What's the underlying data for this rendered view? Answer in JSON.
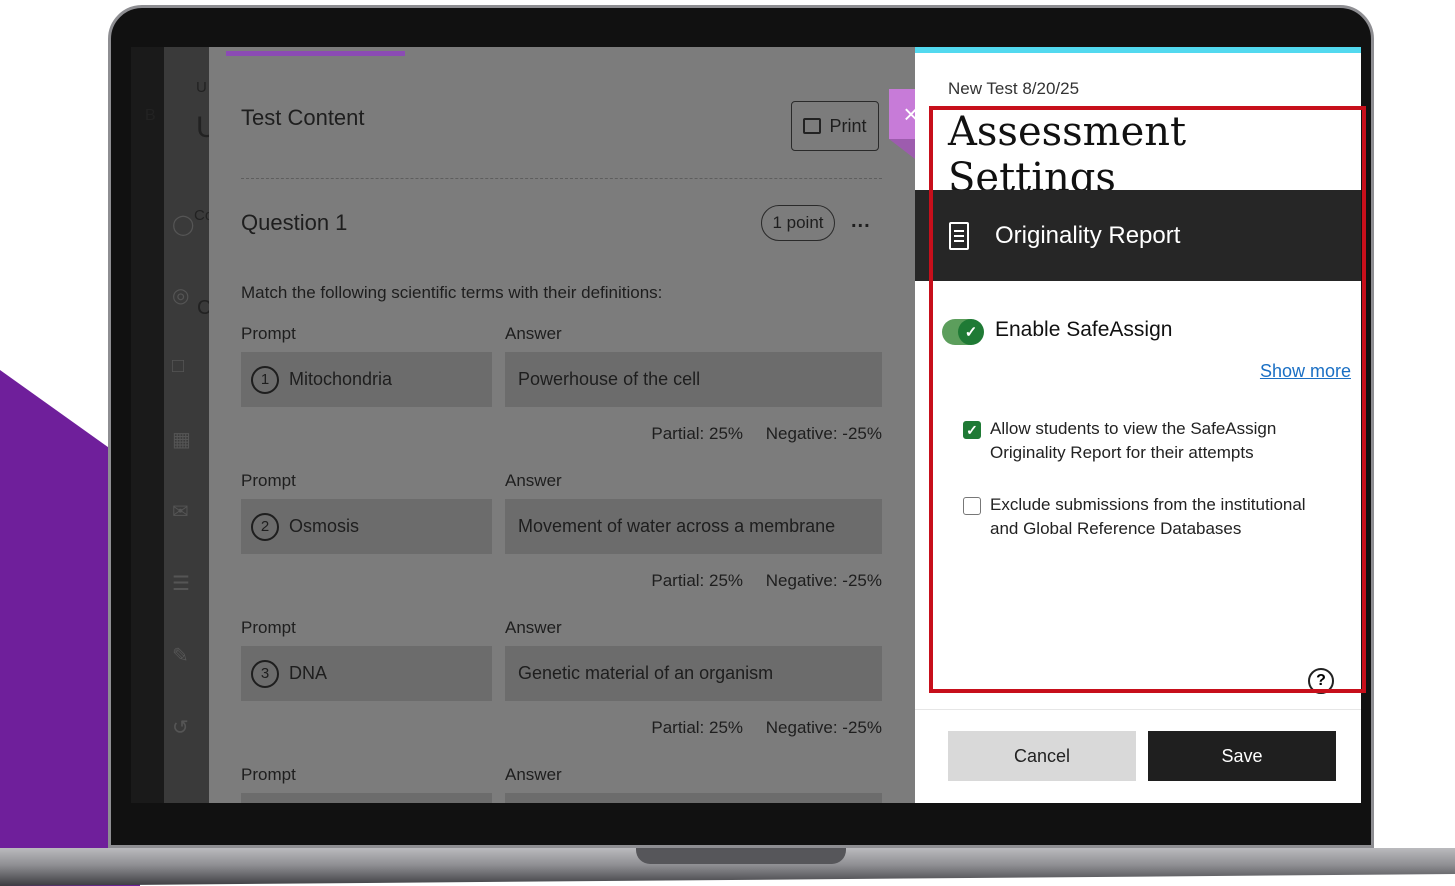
{
  "colors": {
    "accent_purple": "#6f1f9b",
    "toggle_green": "#1f7a35",
    "highlight_red": "#c70f1b",
    "link_blue": "#1a6fc4",
    "top_accent": "#52d9ef"
  },
  "background": {
    "partial_letters": [
      "U",
      "B",
      "U",
      "Co",
      "C"
    ],
    "icons": [
      "user-icon",
      "globe-icon",
      "book-icon",
      "calendar-icon",
      "mail-icon",
      "grades-icon",
      "edit-icon",
      "logout-icon"
    ]
  },
  "test_content": {
    "title": "Test Content",
    "print_label": "Print",
    "question_title": "Question 1",
    "points": "1 point",
    "more": "...",
    "instructions": "Match the following scientific terms with their definitions:",
    "pairs": [
      {
        "number": "1",
        "prompt_label": "Prompt",
        "answer_label": "Answer",
        "prompt": "Mitochondria",
        "answer": "Powerhouse of the cell",
        "partial": "Partial: 25%",
        "negative": "Negative: -25%"
      },
      {
        "number": "2",
        "prompt_label": "Prompt",
        "answer_label": "Answer",
        "prompt": "Osmosis",
        "answer": "Movement of water across a membrane",
        "partial": "Partial: 25%",
        "negative": "Negative: -25%"
      },
      {
        "number": "3",
        "prompt_label": "Prompt",
        "answer_label": "Answer",
        "prompt": "DNA",
        "answer": "Genetic material of an organism",
        "partial": "Partial: 25%",
        "negative": "Negative: -25%"
      },
      {
        "prompt_label": "Prompt",
        "answer_label": "Answer"
      }
    ]
  },
  "close_icon": "×",
  "settings": {
    "breadcrumb": "New Test 8/20/25",
    "title": "Assessment Settings",
    "section_title": "Originality Report",
    "enable_label": "Enable SafeAssign",
    "enable_on": true,
    "show_more": "Show more",
    "options": [
      {
        "label": "Allow students to view the SafeAssign Originality Report for their attempts",
        "checked": true
      },
      {
        "label": "Exclude submissions from the institutional and Global Reference Databases",
        "checked": false
      }
    ],
    "help": "?",
    "cancel_label": "Cancel",
    "save_label": "Save"
  }
}
